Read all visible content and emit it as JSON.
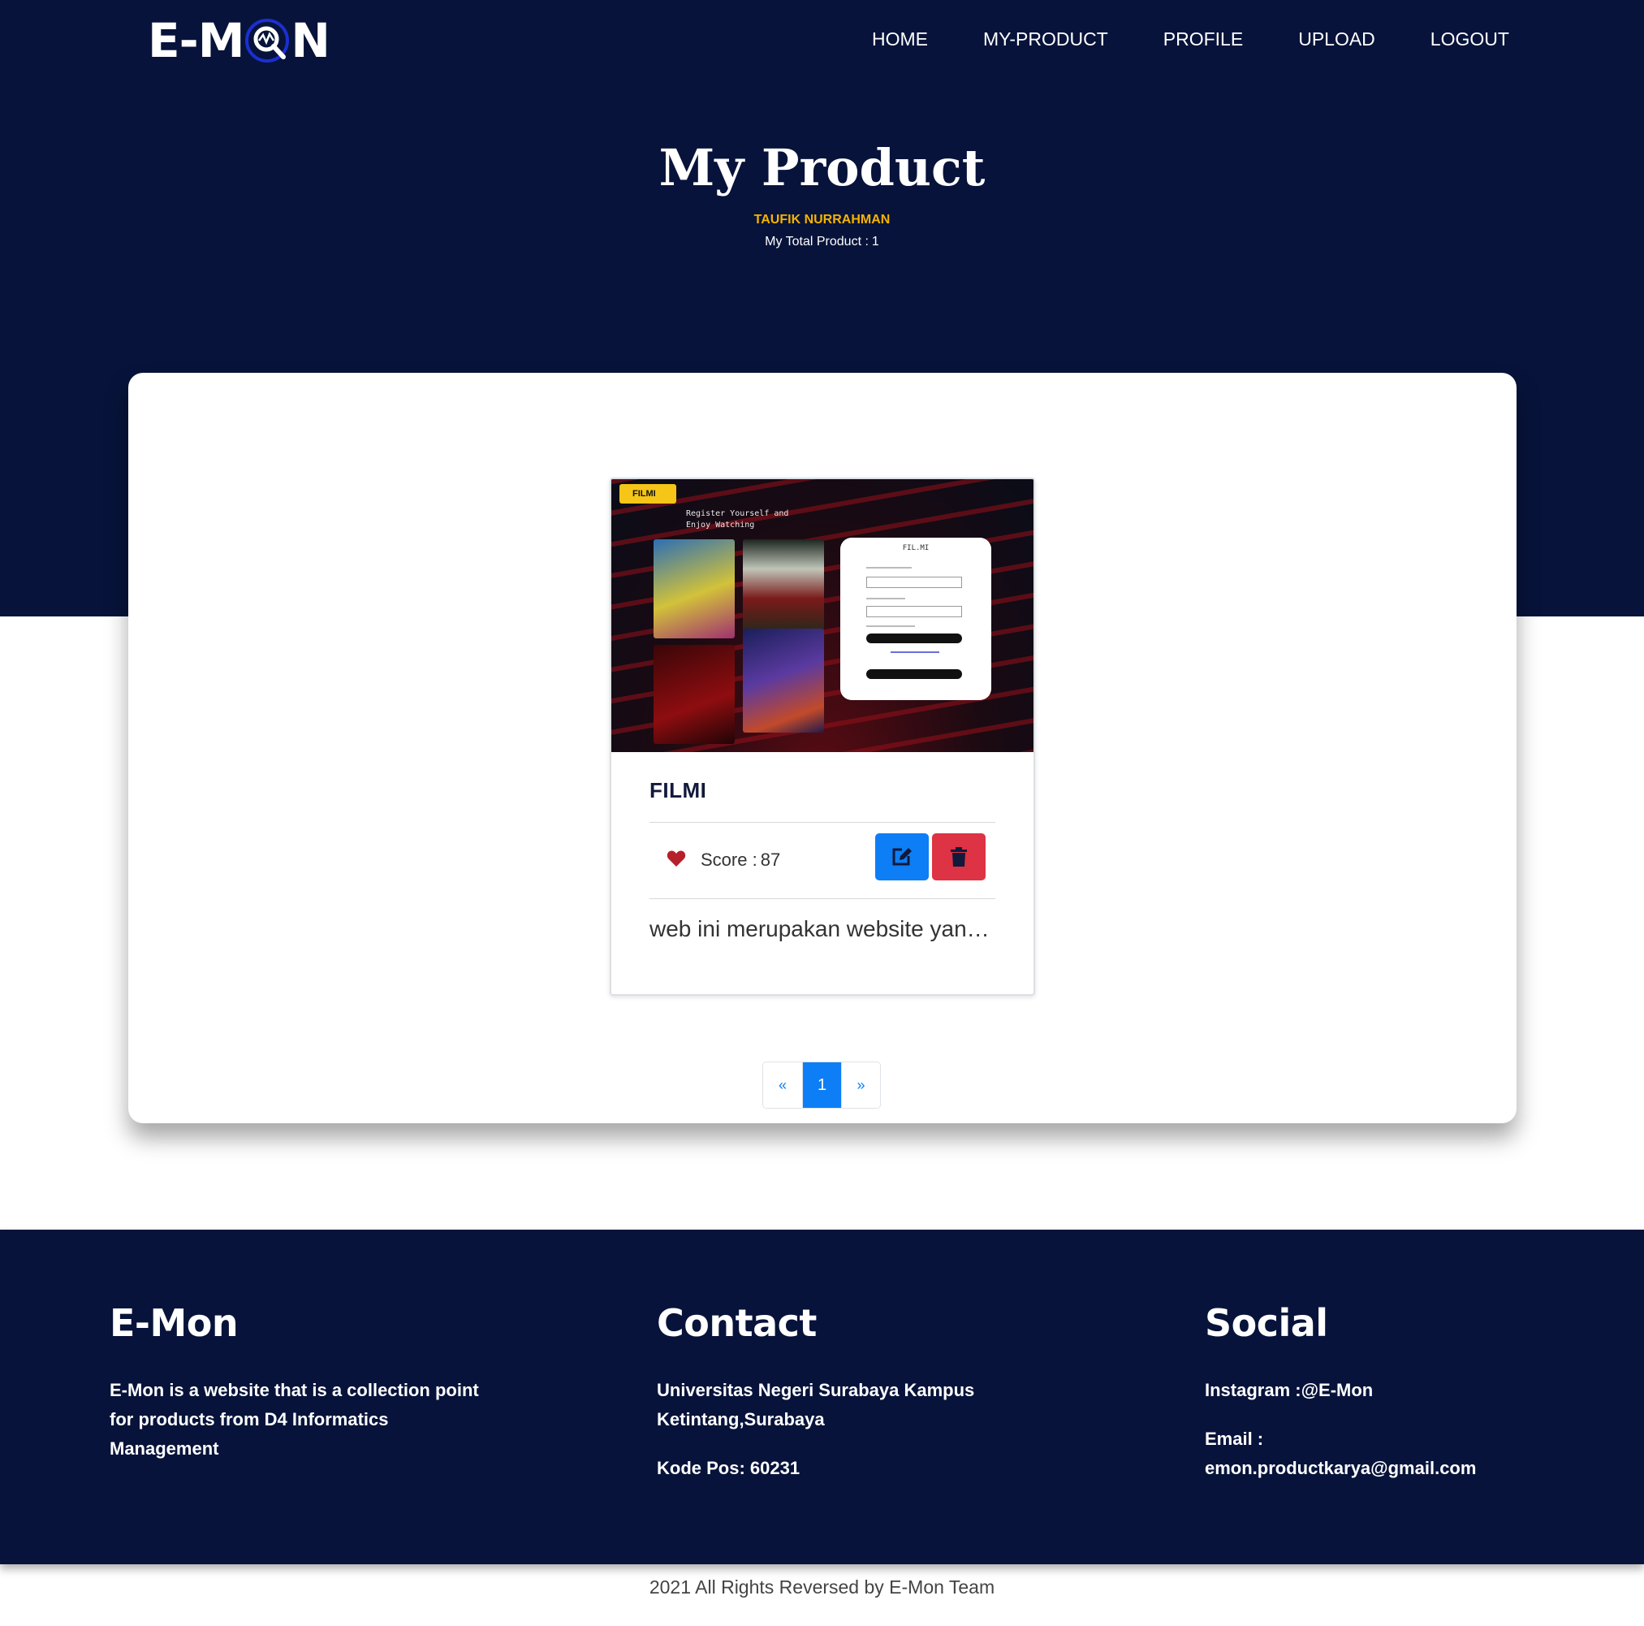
{
  "header": {
    "logo_text_left": "E-M",
    "logo_text_right": "N",
    "nav": [
      {
        "label": "HOME"
      },
      {
        "label": "MY-PRODUCT"
      },
      {
        "label": "PROFILE"
      },
      {
        "label": "UPLOAD"
      },
      {
        "label": "LOGOUT"
      }
    ]
  },
  "hero": {
    "title": "My Product",
    "owner": "TAUFIK NURRAHMAN",
    "total_label": "My Total Product :",
    "total_value": "1"
  },
  "product": {
    "thumbnail": {
      "brand": "FILMI",
      "tagline": "Register Yourself and Enjoy Watching",
      "form_title": "FIL.MI"
    },
    "name": "FILMI",
    "score_label": "Score :",
    "score_value": "87",
    "description": "web ini merupakan website yan…"
  },
  "pagination": {
    "prev": "«",
    "current": "1",
    "next": "»"
  },
  "footer": {
    "about": {
      "heading": "E-Mon",
      "text": "E-Mon is a website that is a collection point for products from D4 Informatics Management"
    },
    "contact": {
      "heading": "Contact",
      "address": "Universitas Negeri Surabaya Kampus Ketintang,Surabaya",
      "postal": "Kode Pos: 60231"
    },
    "social": {
      "heading": "Social",
      "instagram": "Instagram :@E-Mon",
      "email_label": "Email :",
      "email": "emon.productkarya@gmail.com"
    },
    "copyright": "2021 All Rights Reversed by E-Mon Team"
  },
  "colors": {
    "navy": "#07133a",
    "accent_gold": "#f5b300",
    "primary_blue": "#0d7ef5",
    "danger_red": "#dd3344",
    "heart_red": "#b5202a"
  },
  "icons": {
    "edit": "edit-icon",
    "delete": "trash-icon",
    "score": "heart-icon"
  }
}
